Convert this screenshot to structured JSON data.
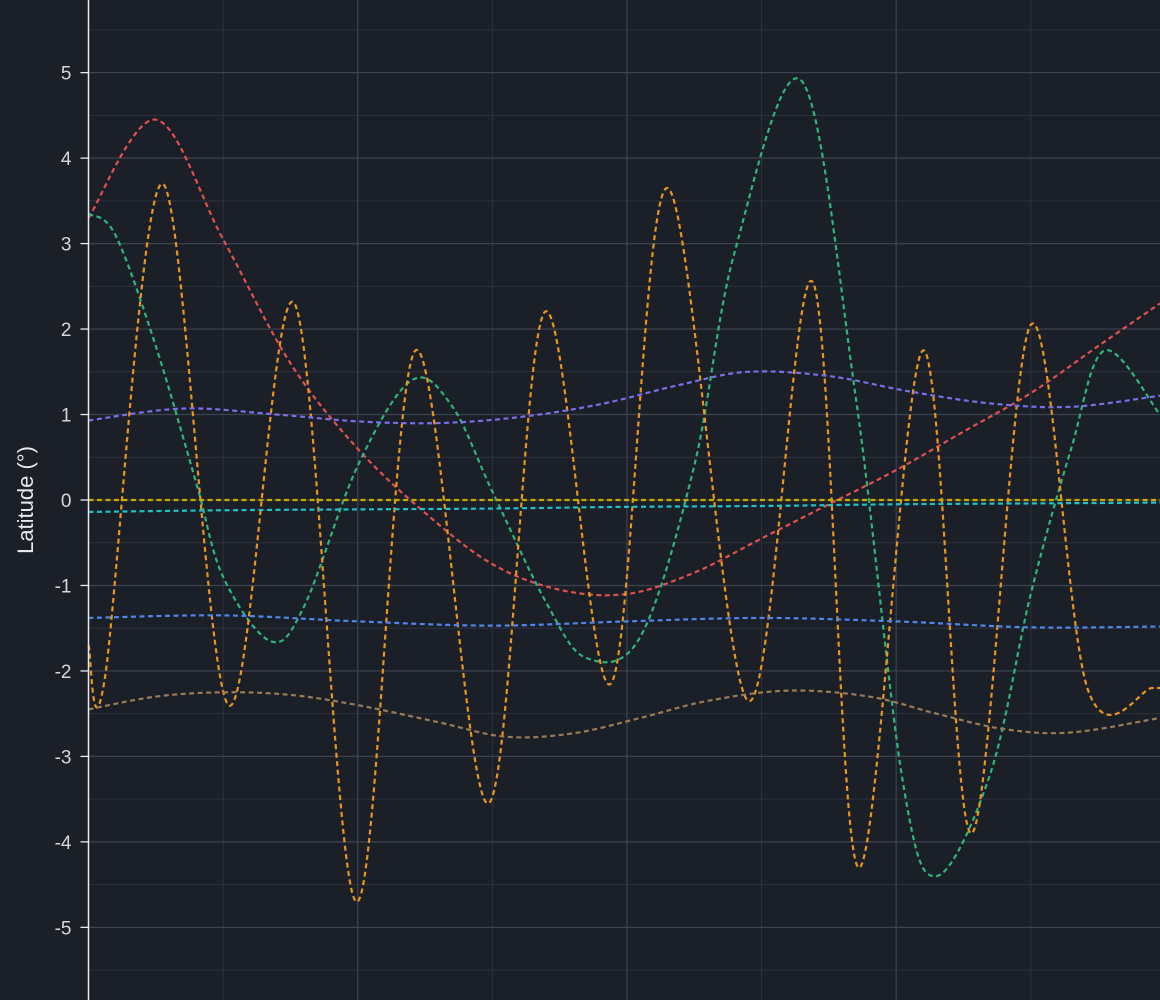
{
  "chart_data": {
    "type": "line",
    "title": "",
    "xlabel": "",
    "ylabel": "Latitude (°)",
    "ylim": [
      -5.85,
      5.85
    ],
    "xlim": [
      0,
      7.96
    ],
    "y_ticks": [
      -5,
      -4,
      -3,
      -2,
      -1,
      0,
      1,
      2,
      3,
      4,
      5
    ],
    "y_tick_labels": [
      "-5",
      "-4",
      "-3",
      "-2",
      "-1",
      "0",
      "1",
      "2",
      "3",
      "4",
      "5"
    ],
    "grid": true,
    "legend": "none",
    "line_style": "dashed",
    "series": [
      {
        "color": "#e0504f",
        "x": [
          0,
          0.5,
          1,
          1.5,
          2,
          2.5,
          3,
          3.5,
          4,
          4.5,
          5,
          5.5,
          6,
          6.5,
          7,
          7.5,
          7.96
        ],
        "y": [
          3.3,
          4.45,
          3.05,
          1.6,
          0.6,
          -0.15,
          -0.75,
          -1.05,
          -1.1,
          -0.85,
          -0.45,
          -0.05,
          0.35,
          0.8,
          1.25,
          1.8,
          2.3
        ]
      },
      {
        "color": "#2eb57a",
        "x": [
          0,
          0.2,
          0.5,
          0.8,
          1.0,
          1.35,
          1.6,
          2.0,
          2.4,
          2.7,
          3.0,
          3.4,
          3.7,
          4.1,
          4.5,
          4.8,
          5.3,
          5.7,
          6.05,
          6.3,
          6.7,
          7.0,
          7.3,
          7.55,
          7.96
        ],
        "y": [
          3.35,
          3.1,
          1.8,
          0.2,
          -0.9,
          -1.65,
          -1.25,
          0.4,
          1.4,
          1.1,
          0.1,
          -1.2,
          -1.85,
          -1.6,
          0.4,
          2.9,
          4.9,
          1.2,
          -3.3,
          -4.4,
          -3.2,
          -1.1,
          0.6,
          1.75,
          1.0
        ]
      },
      {
        "color": "#e8961e",
        "x": [
          0,
          0.12,
          0.55,
          1.04,
          1.53,
          1.99,
          2.43,
          2.97,
          3.39,
          3.88,
          4.3,
          4.9,
          5.38,
          5.72,
          6.2,
          6.56,
          7.0,
          7.42,
          7.9,
          7.96
        ],
        "y": [
          -1.7,
          -2.1,
          3.7,
          -2.4,
          2.3,
          -4.7,
          1.75,
          -3.55,
          2.2,
          -2.15,
          3.65,
          -2.35,
          2.55,
          -4.3,
          1.75,
          -3.9,
          2.05,
          -2.2,
          -2.2,
          -2.2
        ]
      },
      {
        "color": "#7b6ee8",
        "x": [
          0,
          0.7,
          1.4,
          2.0,
          2.6,
          3.2,
          3.8,
          4.4,
          4.9,
          5.5,
          6.1,
          6.7,
          7.3,
          7.96
        ],
        "y": [
          0.93,
          1.07,
          1.0,
          0.92,
          0.9,
          0.97,
          1.12,
          1.35,
          1.5,
          1.45,
          1.27,
          1.13,
          1.09,
          1.22
        ]
      },
      {
        "color": "#c9a800",
        "x": [
          0,
          1,
          2,
          3,
          4,
          5,
          6,
          7,
          7.96
        ],
        "y": [
          0.0,
          0.0,
          0.0,
          0.0,
          0.0,
          0.0,
          0.0,
          0.0,
          0.0
        ]
      },
      {
        "color": "#1ec2c9",
        "x": [
          0,
          1,
          2,
          3,
          4,
          5,
          6,
          7,
          7.96
        ],
        "y": [
          -0.14,
          -0.12,
          -0.11,
          -0.1,
          -0.08,
          -0.07,
          -0.05,
          -0.04,
          -0.03
        ]
      },
      {
        "color": "#4f86e8",
        "x": [
          0,
          1,
          2,
          3,
          4,
          5,
          6,
          7,
          7.96
        ],
        "y": [
          -1.38,
          -1.35,
          -1.42,
          -1.47,
          -1.42,
          -1.38,
          -1.42,
          -1.49,
          -1.48
        ]
      },
      {
        "color": "#9a7b57",
        "x": [
          0,
          0.5,
          1.0,
          1.5,
          2.0,
          2.6,
          3.1,
          3.6,
          4.1,
          4.6,
          5.2,
          5.8,
          6.3,
          6.8,
          7.3,
          7.96
        ],
        "y": [
          -2.45,
          -2.3,
          -2.25,
          -2.28,
          -2.4,
          -2.6,
          -2.77,
          -2.73,
          -2.55,
          -2.35,
          -2.23,
          -2.3,
          -2.5,
          -2.68,
          -2.72,
          -2.55
        ]
      }
    ]
  }
}
